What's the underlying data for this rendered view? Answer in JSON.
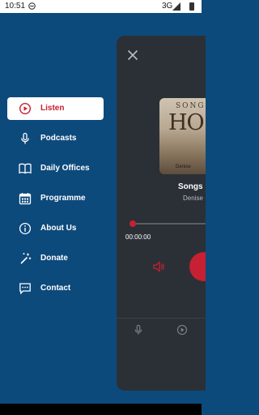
{
  "status": {
    "time": "10:51",
    "network": "3G"
  },
  "menu": {
    "items": [
      {
        "label": "Listen",
        "icon": "play-circle-icon",
        "active": true
      },
      {
        "label": "Podcasts",
        "icon": "microphone-icon"
      },
      {
        "label": "Daily Offices",
        "icon": "book-icon"
      },
      {
        "label": "Programme",
        "icon": "calendar-icon"
      },
      {
        "label": "About Us",
        "icon": "info-icon"
      },
      {
        "label": "Donate",
        "icon": "magic-wand-icon"
      },
      {
        "label": "Contact",
        "icon": "chat-icon"
      }
    ]
  },
  "player": {
    "album_art": {
      "top_text": "SONG",
      "big_text": "HO",
      "bottom_text": "Denise"
    },
    "track_title": "Songs",
    "artist": "Denise",
    "elapsed": "00:00:00",
    "progress": 0
  },
  "colors": {
    "background": "#0d4a7c",
    "accent": "#c62032",
    "panel": "#2b3036"
  }
}
